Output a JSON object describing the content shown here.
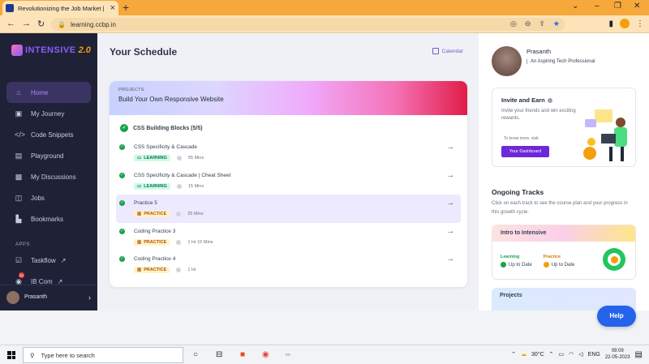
{
  "browser": {
    "tab_title": "Revolutionizing the Job Market |",
    "url": "learning.ccbp.in"
  },
  "sidebar": {
    "logo_text": "INTENSIVE",
    "logo_version": "2.0",
    "items": [
      {
        "label": "Home",
        "icon": "home-icon"
      },
      {
        "label": "My Journey",
        "icon": "journey-icon"
      },
      {
        "label": "Code Snippets",
        "icon": "code-icon"
      },
      {
        "label": "Playground",
        "icon": "playground-icon"
      },
      {
        "label": "My Discussions",
        "icon": "discussions-icon"
      },
      {
        "label": "Jobs",
        "icon": "jobs-icon"
      },
      {
        "label": "Bookmarks",
        "icon": "bookmark-icon"
      }
    ],
    "apps_label": "APPS",
    "apps": [
      {
        "label": "Taskflow",
        "icon": "taskflow-icon"
      },
      {
        "label": "IB Com",
        "icon": "ibcom-icon",
        "badge": "24"
      }
    ],
    "user_name": "Prasanth"
  },
  "main": {
    "title": "Your Schedule",
    "calendar_label": "Calendar",
    "banner_label": "PROJECTS",
    "banner_title": "Build Your Own Responsive Website",
    "section_title": "CSS Building Blocks (5/5)",
    "rows": [
      {
        "name": "CSS Specificity & Cascade",
        "tag": "LEARNING",
        "duration": "55 Mins"
      },
      {
        "name": "CSS Specificity & Cascade | Cheat Sheet",
        "tag": "LEARNING",
        "duration": "15 Mins"
      },
      {
        "name": "Practice 5",
        "tag": "PRACTICE",
        "duration": "25 Mins"
      },
      {
        "name": "Coding Practice 3",
        "tag": "PRACTICE",
        "duration": "1 Hr 15 Mins"
      },
      {
        "name": "Coding Practice 4",
        "tag": "PRACTICE",
        "duration": "1 Hr"
      }
    ]
  },
  "right": {
    "profile_name": "Prasanth",
    "profile_role": "An Aspiring Tech Professional",
    "invite_title": "Invite and Earn",
    "invite_desc": "Invite your friends and win exciting rewards.",
    "invite_know": "To know more, visit",
    "invite_button": "Your Dashboard",
    "ongoing_title": "Ongoing Tracks",
    "ongoing_desc": "Click on each track to see the course plan and your progress in this growth cycle.",
    "intro_title": "Intro to Intensive",
    "learning_label": "Learning",
    "learning_status": "Up to Date",
    "practice_label": "Practice",
    "practice_status": "Up to Date",
    "projects_title": "Projects",
    "help_label": "Help"
  },
  "taskbar": {
    "search_placeholder": "Type here to search",
    "temperature": "30°C",
    "language": "ENG",
    "time": "09:09",
    "date": "22-05-2023"
  },
  "colors": {
    "accent": "#6d28d9",
    "sidebar_bg": "#1f2237",
    "success": "#16a34a"
  }
}
